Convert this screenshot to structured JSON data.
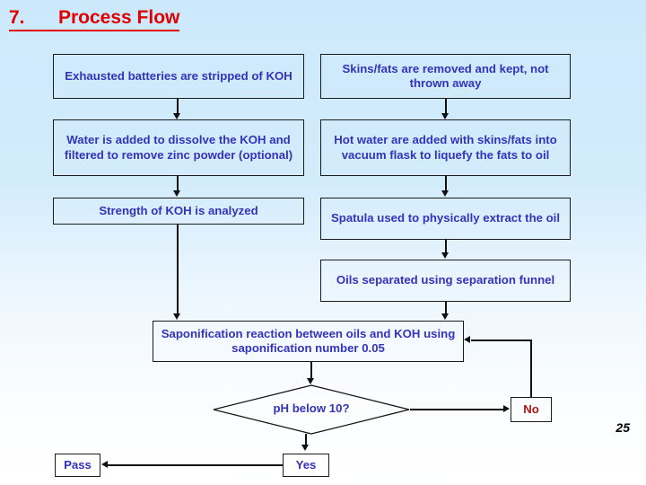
{
  "slide": {
    "title_number": "7.",
    "title_text": "Process Flow",
    "page_number": "25",
    "colors": {
      "title": "#e00000",
      "box_text": "#3333bb",
      "no_text": "#a8171a",
      "connector": "#111111",
      "background_top": "#cce9fb",
      "background_bottom": "#ffffff"
    }
  },
  "flow": {
    "boxes": [
      {
        "id": "exhausted-batteries",
        "label": "Exhausted batteries are stripped of KOH"
      },
      {
        "id": "skins-fats-removed",
        "label": "Skins/fats are removed and kept, not thrown away"
      },
      {
        "id": "water-added-dissolve",
        "label": "Water is added to dissolve the KOH and filtered to remove zinc powder (optional)"
      },
      {
        "id": "hot-water-added",
        "label": "Hot water are added with skins/fats into vacuum flask to liquefy the fats to oil"
      },
      {
        "id": "strength-koh-analyzed",
        "label": "Strength of KOH is analyzed"
      },
      {
        "id": "spatula-extract-oil",
        "label": "Spatula used to physically extract the oil"
      },
      {
        "id": "oils-separated",
        "label": "Oils separated using separation funnel"
      },
      {
        "id": "saponification-reaction",
        "label": "Saponification reaction between oils and KOH using saponification number 0.05"
      }
    ],
    "decision": {
      "id": "ph-below-10",
      "label": "pH below 10?"
    },
    "outcomes": [
      {
        "id": "no",
        "label": "No"
      },
      {
        "id": "yes",
        "label": "Yes"
      },
      {
        "id": "pass",
        "label": "Pass"
      }
    ]
  }
}
